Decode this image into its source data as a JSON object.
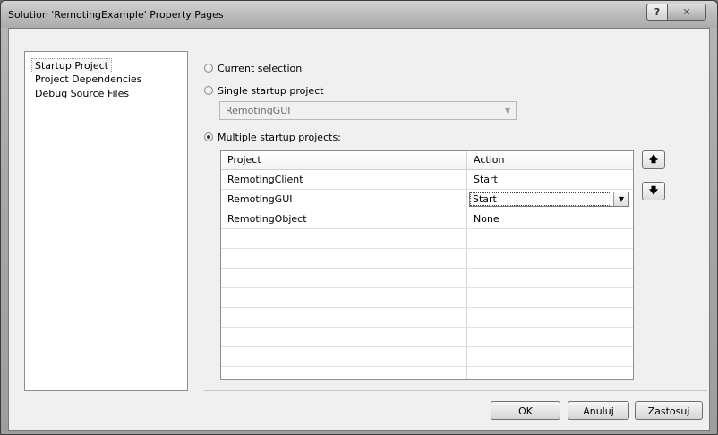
{
  "window": {
    "title": "Solution 'RemotingExample' Property Pages",
    "help_label": "?",
    "close_label": "✕"
  },
  "nav": {
    "items": [
      {
        "label": "Startup Project",
        "selected": true
      },
      {
        "label": "Project Dependencies",
        "selected": false
      },
      {
        "label": "Debug Source Files",
        "selected": false
      }
    ]
  },
  "startup": {
    "current_selection_label": "Current selection",
    "single_label": "Single startup project",
    "single_value": "RemotingGUI",
    "multiple_label": "Multiple startup projects:",
    "selected_option": "multiple"
  },
  "grid": {
    "headers": {
      "project": "Project",
      "action": "Action"
    },
    "rows": [
      {
        "project": "RemotingClient",
        "action": "Start"
      },
      {
        "project": "RemotingGUI",
        "action": "Start"
      },
      {
        "project": "RemotingObject",
        "action": "None"
      }
    ]
  },
  "side_buttons": {
    "up": "🡅",
    "down": "🡇"
  },
  "buttons": {
    "ok": "OK",
    "cancel": "Anuluj",
    "apply": "Zastosuj"
  }
}
